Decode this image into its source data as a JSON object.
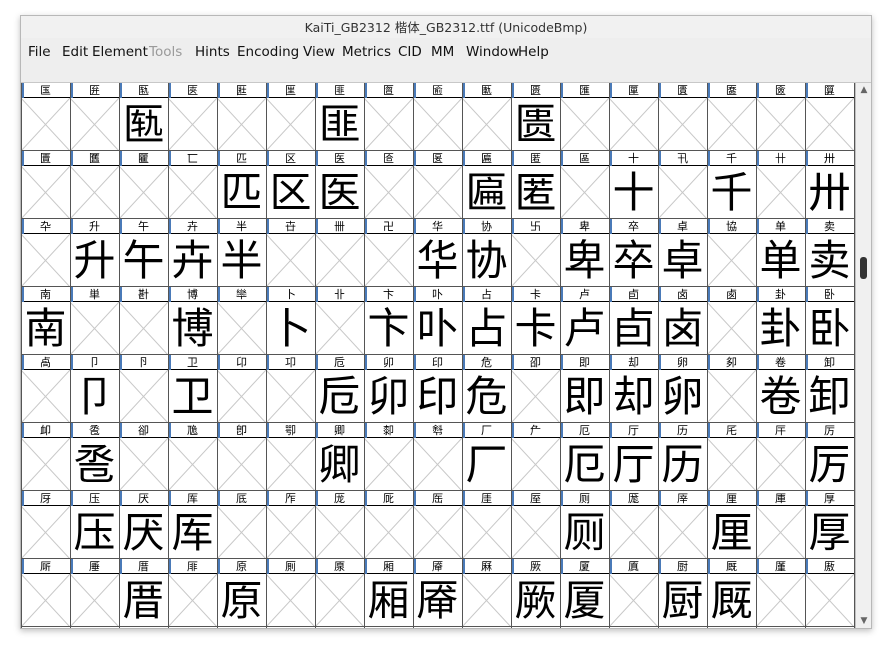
{
  "window": {
    "title": "KaiTi_GB2312 楷体_GB2312.ttf (UnicodeBmp)"
  },
  "menu": [
    "File",
    "Edit",
    "Element",
    "Tools",
    "Hints",
    "Encoding",
    "View",
    "Metrics",
    "CID",
    "MM",
    "Window",
    "Help"
  ],
  "menu_disabled": [
    "Tools"
  ],
  "rows": [
    {
      "labels": [
        "匤",
        "匥",
        "匦",
        "匧",
        "匨",
        "匩",
        "匪",
        "匫",
        "匬",
        "匭",
        "匮",
        "匯",
        "匰",
        "匱",
        "匲",
        "匳",
        "匴"
      ],
      "glyphs": [
        "",
        "",
        "匦",
        "",
        "",
        "",
        "匪",
        "",
        "",
        "",
        "匮",
        "",
        "",
        "",
        "",
        "",
        ""
      ]
    },
    {
      "labels": [
        "匵",
        "匶",
        "匷",
        "匸",
        "匹",
        "区",
        "医",
        "匼",
        "匽",
        "匾",
        "匿",
        "區",
        "十",
        "卂",
        "千",
        "卄",
        "卅"
      ],
      "glyphs": [
        "",
        "",
        "",
        "",
        "匹",
        "区",
        "医",
        "",
        "",
        "匾",
        "匿",
        "",
        "十",
        "",
        "千",
        "",
        "卅"
      ]
    },
    {
      "labels": [
        "卆",
        "升",
        "午",
        "卉",
        "半",
        "卋",
        "卌",
        "卍",
        "华",
        "协",
        "卐",
        "卑",
        "卒",
        "卓",
        "協",
        "单",
        "卖"
      ],
      "glyphs": [
        "",
        "升",
        "午",
        "卉",
        "半",
        "",
        "",
        "",
        "华",
        "协",
        "",
        "卑",
        "卒",
        "卓",
        "",
        "单",
        "卖"
      ]
    },
    {
      "labels": [
        "南",
        "単",
        "卙",
        "博",
        "卛",
        "卜",
        "卝",
        "卞",
        "卟",
        "占",
        "卡",
        "卢",
        "卣",
        "卤",
        "卥",
        "卦",
        "卧"
      ],
      "glyphs": [
        "南",
        "",
        "",
        "博",
        "",
        "卜",
        "",
        "卞",
        "卟",
        "占",
        "卡",
        "卢",
        "卣",
        "卤",
        "",
        "卦",
        "卧"
      ]
    },
    {
      "labels": [
        "卨",
        "卩",
        "卪",
        "卫",
        "卬",
        "卭",
        "卮",
        "卯",
        "印",
        "危",
        "卲",
        "即",
        "却",
        "卵",
        "卶",
        "卷",
        "卸"
      ],
      "glyphs": [
        "",
        "卩",
        "",
        "卫",
        "",
        "",
        "卮",
        "卯",
        "印",
        "危",
        "",
        "即",
        "却",
        "卵",
        "",
        "卷",
        "卸"
      ]
    },
    {
      "labels": [
        "卹",
        "卺",
        "卻",
        "卼",
        "卽",
        "卾",
        "卿",
        "厀",
        "厁",
        "厂",
        "厃",
        "厄",
        "厅",
        "历",
        "厇",
        "厈",
        "厉"
      ],
      "glyphs": [
        "",
        "卺",
        "",
        "",
        "",
        "",
        "卿",
        "",
        "",
        "厂",
        "",
        "厄",
        "厅",
        "历",
        "",
        "",
        "厉"
      ]
    },
    {
      "labels": [
        "厊",
        "压",
        "厌",
        "厍",
        "厎",
        "厏",
        "厐",
        "厑",
        "厒",
        "厓",
        "厔",
        "厕",
        "厖",
        "厗",
        "厘",
        "厙",
        "厚"
      ],
      "glyphs": [
        "",
        "压",
        "厌",
        "厍",
        "",
        "",
        "",
        "",
        "",
        "",
        "",
        "厕",
        "",
        "",
        "厘",
        "",
        "厚"
      ]
    },
    {
      "labels": [
        "厛",
        "厜",
        "厝",
        "厞",
        "原",
        "厠",
        "厡",
        "厢",
        "厣",
        "厤",
        "厥",
        "厦",
        "厧",
        "厨",
        "厩",
        "厪",
        "厫"
      ],
      "glyphs": [
        "",
        "",
        "厝",
        "",
        "原",
        "",
        "",
        "厢",
        "厣",
        "",
        "厥",
        "厦",
        "",
        "厨",
        "厩",
        "",
        ""
      ]
    }
  ]
}
